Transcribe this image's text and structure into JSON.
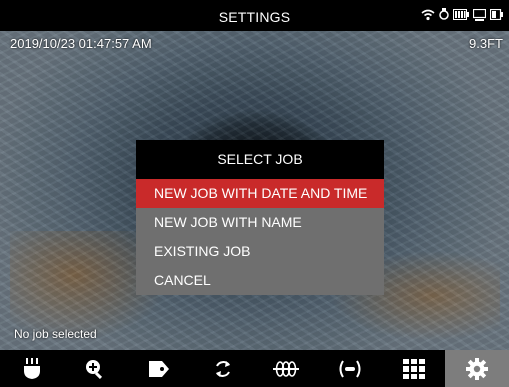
{
  "header": {
    "title": "SETTINGS"
  },
  "status_icons": [
    "wifi-icon",
    "camera-icon",
    "battery-icon",
    "monitor-icon",
    "external-battery-icon"
  ],
  "overlay": {
    "timestamp": "2019/10/23 01:47:57 AM",
    "distance": "9.3FT",
    "job_status": "No job selected"
  },
  "dialog": {
    "title": "SELECT JOB",
    "items": [
      {
        "label": "NEW JOB WITH DATE AND TIME",
        "selected": true
      },
      {
        "label": "NEW JOB WITH NAME",
        "selected": false
      },
      {
        "label": "EXISTING JOB",
        "selected": false
      },
      {
        "label": "CANCEL",
        "selected": false
      }
    ]
  },
  "toolbar": {
    "items": [
      {
        "icon": "lights-icon"
      },
      {
        "icon": "zoom-in-icon"
      },
      {
        "icon": "tag-icon"
      },
      {
        "icon": "rotate-icon"
      },
      {
        "icon": "sonde-icon"
      },
      {
        "icon": "transmitter-icon"
      },
      {
        "icon": "grid-icon"
      },
      {
        "icon": "gear-icon",
        "active": true
      }
    ]
  },
  "colors": {
    "selected": "#c92a2a",
    "menu_item_bg": "#6f6f6f",
    "active_tool_bg": "#7d7d7d"
  }
}
